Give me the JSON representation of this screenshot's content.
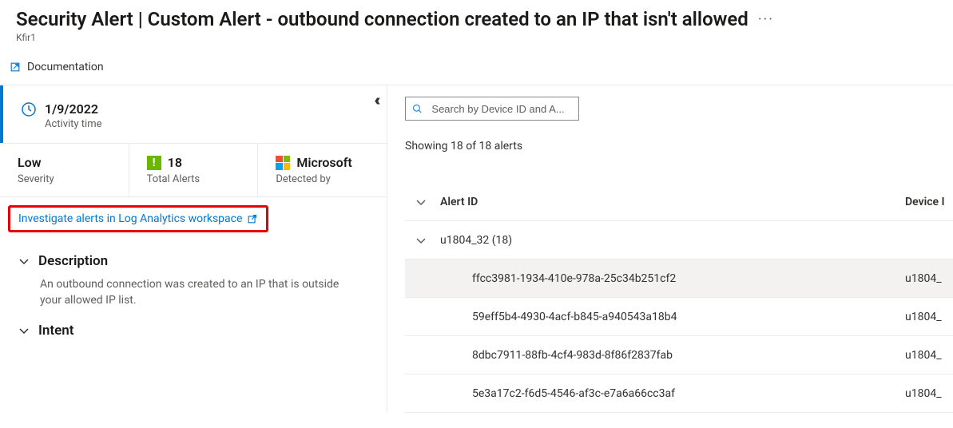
{
  "header": {
    "title": "Security Alert | Custom Alert - outbound connection created to an IP that isn't allowed",
    "subtitle": "Kfir1",
    "ellipsis": "···"
  },
  "toolbar": {
    "documentation": "Documentation"
  },
  "collapse_glyph": "‹‹",
  "summary": {
    "activity_date": "1/9/2022",
    "activity_label": "Activity time",
    "severity_value": "Low",
    "severity_label": "Severity",
    "total_alerts_badge": "!",
    "total_alerts_value": "18",
    "total_alerts_label": "Total Alerts",
    "detected_by_value": "Microsoft",
    "detected_by_label": "Detected by"
  },
  "investigate": {
    "text": "Investigate alerts in Log Analytics workspace"
  },
  "description": {
    "header": "Description",
    "body": "An outbound connection was created to an IP that is outside your allowed IP list."
  },
  "intent": {
    "header": "Intent"
  },
  "right": {
    "search_placeholder": "Search by Device ID and A...",
    "showing": "Showing 18 of 18 alerts",
    "columns": {
      "alert_id": "Alert ID",
      "device": "Device I"
    },
    "group": {
      "label": "u1804_32 (18)"
    },
    "rows": [
      {
        "alert_id": "ffcc3981-1934-410e-978a-25c34b251cf2",
        "device": "u1804_",
        "active": true
      },
      {
        "alert_id": "59eff5b4-4930-4acf-b845-a940543a18b4",
        "device": "u1804_",
        "active": false
      },
      {
        "alert_id": "8dbc7911-88fb-4cf4-983d-8f86f2837fab",
        "device": "u1804_",
        "active": false
      },
      {
        "alert_id": "5e3a17c2-f6d5-4546-af3c-e7a6a66cc3af",
        "device": "u1804_",
        "active": false
      }
    ]
  }
}
